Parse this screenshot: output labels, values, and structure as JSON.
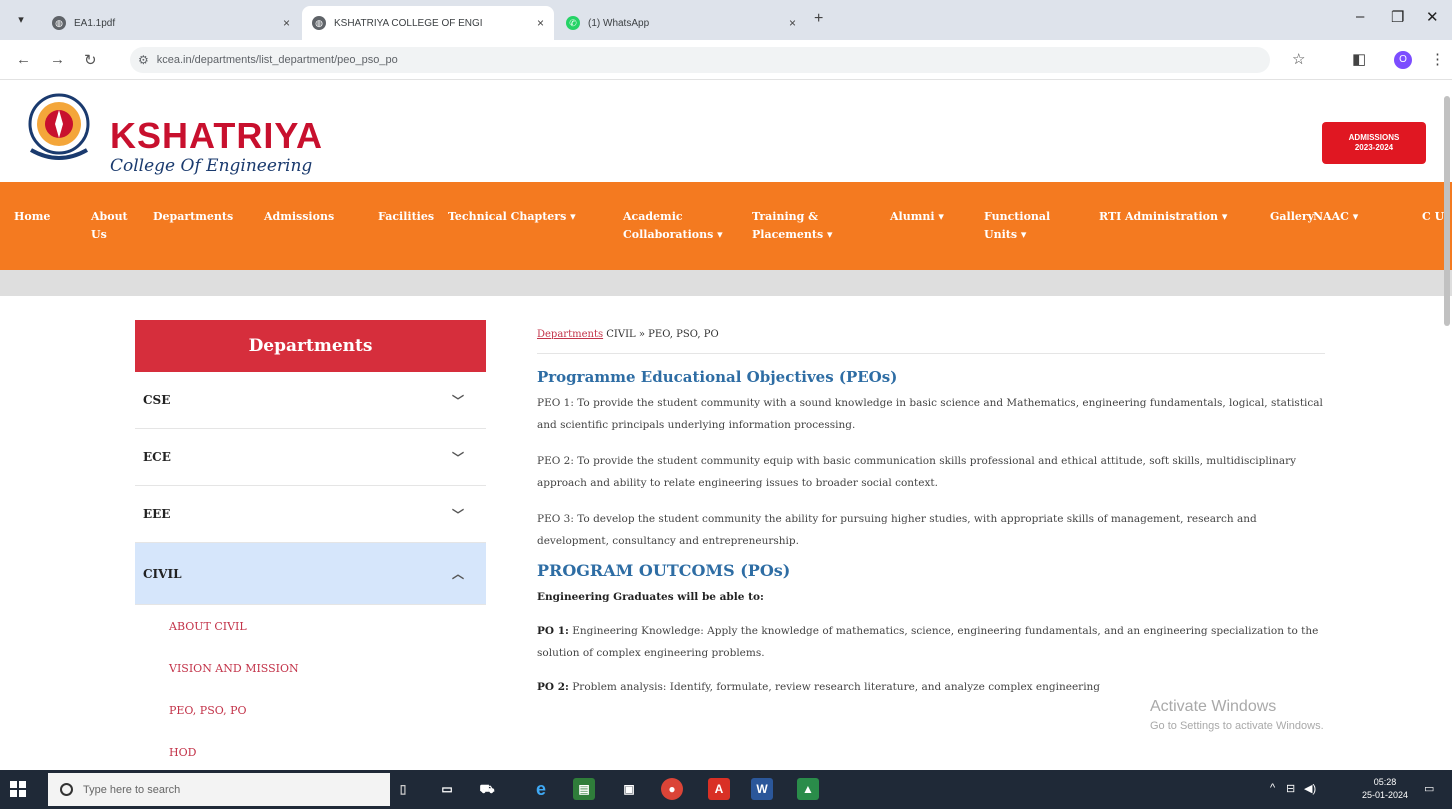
{
  "browser": {
    "tabs": [
      {
        "title": "EA1.1pdf",
        "active": false,
        "icon": "globe-icon"
      },
      {
        "title": "KSHATRIYA COLLEGE OF ENGI",
        "active": true,
        "icon": "globe-icon"
      },
      {
        "title": "(1) WhatsApp",
        "active": false,
        "icon": "whatsapp-icon"
      }
    ],
    "url": "kcea.in/departments/list_department/peo_pso_po",
    "profile_initial": "O"
  },
  "header": {
    "logo_name": "KSHATRIYA",
    "logo_sub": "College Of Engineering",
    "admissions_line1": "ADMISSIONS",
    "admissions_line2": "2023-2024"
  },
  "nav": [
    {
      "label": "Home"
    },
    {
      "label": "About Us"
    },
    {
      "label": "Departments"
    },
    {
      "label": "Admissions"
    },
    {
      "label": "Facilities"
    },
    {
      "label": "Technical Chapters ▾"
    },
    {
      "label": "Academic Collaborations ▾"
    },
    {
      "label": "Training & Placements ▾"
    },
    {
      "label": "Alumni ▾"
    },
    {
      "label": "Functional Units ▾"
    },
    {
      "label": "RTI"
    },
    {
      "label": "Administration ▾"
    },
    {
      "label": "Gallery"
    },
    {
      "label": "NAAC ▾"
    },
    {
      "label": "C U"
    }
  ],
  "sidebar": {
    "title": "Departments",
    "departments": [
      {
        "label": "CSE",
        "expanded": false
      },
      {
        "label": "ECE",
        "expanded": false
      },
      {
        "label": "EEE",
        "expanded": false
      },
      {
        "label": "CIVIL",
        "expanded": true
      }
    ],
    "sub_items": [
      "ABOUT CIVIL",
      "VISION AND MISSION",
      "PEO, PSO, PO",
      "HOD"
    ]
  },
  "content": {
    "breadcrumb_link": "Departments",
    "breadcrumb_rest": " CIVIL  »  PEO, PSO, PO",
    "peo_heading": "Programme Educational Objectives (PEOs)",
    "peo1": "PEO 1: To provide the student community with a sound knowledge in basic science and Mathematics, engineering fundamentals, logical, statistical and scientific principals underlying information processing.",
    "peo2": "PEO 2: To provide the student community equip with basic communication skills professional and ethical attitude, soft skills, multidisciplinary approach and ability to relate engineering issues to broader social context.",
    "peo3": "PEO 3: To develop the student community the ability for pursuing higher studies, with appropriate skills of management, research and development, consultancy and entrepreneurship.",
    "po_heading": "PROGRAM OUTCOMS (POs)",
    "po_intro": "Engineering Graduates will be able to:",
    "po1_label": "PO 1:",
    "po1_text": " Engineering Knowledge: Apply the knowledge of mathematics, science, engineering fundamentals, and an engineering specialization to the solution of complex engineering problems.",
    "po2_label": "PO 2:",
    "po2_text": " Problem analysis: Identify, formulate, review research literature, and analyze complex engineering"
  },
  "watermark": {
    "line1": "Activate Windows",
    "line2": "Go to Settings to activate Windows."
  },
  "taskbar": {
    "search_placeholder": "Type here to search",
    "time": "05:28",
    "date": "25-01-2024"
  }
}
